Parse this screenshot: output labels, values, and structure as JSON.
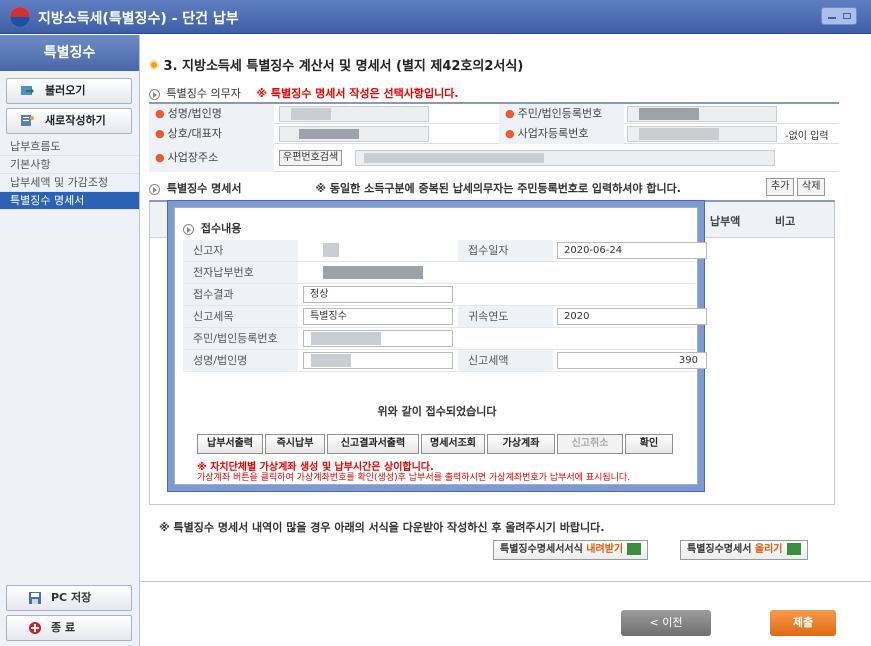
{
  "window": {
    "title": "지방소득세(특별징수) - 단건 납부"
  },
  "sidebar": {
    "header": "특별징수",
    "load_label": "불러오기",
    "new_label": "새로작성하기",
    "items": [
      {
        "label": "납부흐름도"
      },
      {
        "label": "기본사항"
      },
      {
        "label": "납부세액 및 가감조정"
      },
      {
        "label": "특별징수 명세서"
      }
    ],
    "save_label": "PC 저장",
    "exit_label": "종 료"
  },
  "main": {
    "section_title": "3. 지방소득세 특별징수 계산서 및 명세서 (별지 제42호의2서식)",
    "obligor_label": "특별징수 의무자",
    "obligor_warning": "※ 특별징수 명세서 작성은 선택사항입니다.",
    "fields": {
      "name_label": "성명/법인명",
      "reg_no_label": "주민/법인등록번호",
      "company_label": "상호/대표자",
      "biz_no_label": "사업자등록번호",
      "no_input_note": "-없이 입력",
      "address_label": "사업장주소",
      "zip_button": "우편번호검색"
    },
    "detail_label": "특별징수 명세서",
    "detail_note": "※ 동일한 소득구분에 중복된 납세의무자는 주민등록번호로 입력하셔야 합니다.",
    "add_button": "추가",
    "delete_button": "삭제",
    "table_headers": {
      "amount": "납부액",
      "note": "비고"
    },
    "bottom_note": "※ 특별징수 명세서 내역이 많을 경우 아래의 서식을 다운받아 작성하신 후 올려주시기 바랍니다.",
    "download_btn": {
      "prefix": "특별징수명세서서식 ",
      "highlight": "내려받기"
    },
    "upload_btn": {
      "prefix": "특별징수명세서 ",
      "highlight": "올리기"
    },
    "prev_button": "< 이전",
    "submit_button": "제출"
  },
  "modal": {
    "title": "접수내용",
    "labels": {
      "reporter": "신고자",
      "receipt_date": "접수일자",
      "e_pay_no": "전자납부번호",
      "result": "접수결과",
      "tax_item": "신고세목",
      "tax_year": "귀속연도",
      "reg_no": "주민/법인등록번호",
      "name": "성명/법인명",
      "tax_amount": "신고세액"
    },
    "values": {
      "receipt_date": "2020-06-24",
      "result": "정상",
      "tax_item": "특별징수",
      "tax_year": "2020",
      "tax_amount": "390"
    },
    "message": "위와 같이 접수되었습니다",
    "buttons": [
      "납부서출력",
      "즉시납부",
      "신고결과서출력",
      "명세서조회",
      "가상계좌",
      "신고취소",
      "확인"
    ],
    "warning1": "※ 자치단체별 가상계좌 생성 및 납부시간은 상이합니다.",
    "warning2": "가상계좌 버튼을 클릭하여 가상계좌번호를 확인(생성)후 납부서를 출력하시면 가상계좌번호가 납부서에 표시됩니다."
  }
}
